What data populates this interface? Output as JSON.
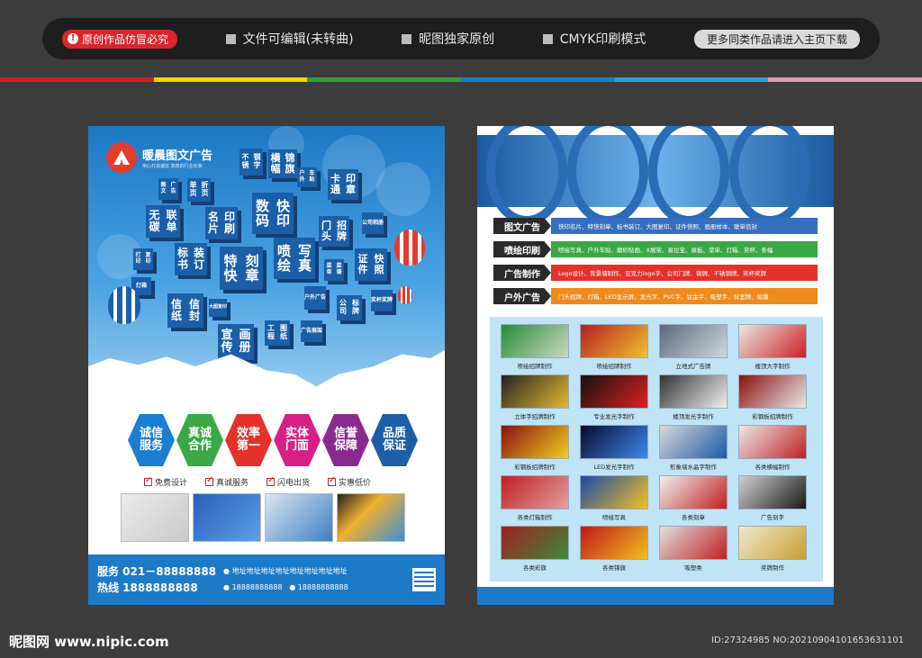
{
  "top_banner": {
    "badge": "原创作品仿冒必究",
    "item1": "文件可编辑(未转曲)",
    "item2": "昵图独家原创",
    "item3": "CMYK印刷模式",
    "more": "更多同类作品请进入主页下载"
  },
  "colors": {
    "bar": [
      "#d21f26",
      "#f5d800",
      "#2ca33a",
      "#1b7fc7",
      "#2ca0d8",
      "#e49aa9"
    ]
  },
  "left_flyer": {
    "brand": "暖晨图文广告",
    "brand_sub": "用心打造诚信   高效的行业标准",
    "cubes": [
      {
        "t": "不锈钢字"
      },
      {
        "t": "横幅锦旗"
      },
      {
        "t": "图文广告"
      },
      {
        "t": "单页折页"
      },
      {
        "t": "户外车贴"
      },
      {
        "t": "卡通印章"
      },
      {
        "t": "无碳联单"
      },
      {
        "t": "名片印刷"
      },
      {
        "t": "数码快印"
      },
      {
        "t": "门头招牌"
      },
      {
        "t": "公司相册"
      },
      {
        "t": "打印复印"
      },
      {
        "t": "标书装订"
      },
      {
        "t": "特快刻章"
      },
      {
        "t": "喷绘写真"
      },
      {
        "t": "证件快照"
      },
      {
        "t": "灯箱"
      },
      {
        "t": "菜单菜谱"
      },
      {
        "t": "信纸信封"
      },
      {
        "t": "大图复印"
      },
      {
        "t": "户外广告"
      },
      {
        "t": "公司标牌"
      },
      {
        "t": "奖杯奖牌"
      },
      {
        "t": "宣传画册"
      },
      {
        "t": "工程图纸"
      },
      {
        "t": "广告展架"
      }
    ],
    "hexes": [
      {
        "t": "诚信服务",
        "c": "#1a7fd0"
      },
      {
        "t": "真诚合作",
        "c": "#3aa845"
      },
      {
        "t": "效率第一",
        "c": "#e4322b"
      },
      {
        "t": "实体门面",
        "c": "#d81f83"
      },
      {
        "t": "信誉保障",
        "c": "#8a2a8f"
      },
      {
        "t": "品质保证",
        "c": "#1c5ea8"
      }
    ],
    "checks": [
      "免费设计",
      "真诚服务",
      "闪电出货",
      "实惠低价"
    ],
    "service_line": "服务 021－88888888",
    "hotline": "热线 1888888888",
    "address": "地址地址地址地址地址地址地址地址",
    "phone1": "18888888888",
    "phone2": "18888888888"
  },
  "right_flyer": {
    "services": [
      {
        "label": "图文广告",
        "text": "快印名片、特快刻章、标书装订、大图复印、证件快照、画册样本、联单信封",
        "c": "#3570c0"
      },
      {
        "label": "喷绘印刷",
        "text": "喷绘写真、户外车贴、磨砂贴画、X展架、易拉宝、展板、菜单、灯箱、奖杯、条幅",
        "c": "#3aa845"
      },
      {
        "label": "广告制作",
        "text": "Logo设计、背景墙制作、亚克力logo字、公司门牌、铜牌、不锈钢牌、奖杯奖牌",
        "c": "#e4322b"
      },
      {
        "label": "户外广告",
        "text": "门头招牌、灯箱、LED显示屏、发光字、PVC字、钛金字、吸塑字、科室牌、贴膜",
        "c": "#ef8a1c"
      }
    ],
    "cells": [
      {
        "cap": "喷绘招牌制作"
      },
      {
        "cap": "喷绘招牌制作"
      },
      {
        "cap": "立地式广告牌"
      },
      {
        "cap": "楼顶大字制作"
      },
      {
        "cap": "立体字招牌制作"
      },
      {
        "cap": "专业发光字制作"
      },
      {
        "cap": "楼顶发光字制作"
      },
      {
        "cap": "彩钢板招牌制作"
      },
      {
        "cap": "彩钢板招牌制作"
      },
      {
        "cap": "LED发光字制作"
      },
      {
        "cap": "形象墙水晶字制作"
      },
      {
        "cap": "各类横幅制作"
      },
      {
        "cap": "各类灯箱制作"
      },
      {
        "cap": "喷绘写真"
      },
      {
        "cap": "各类刻章"
      },
      {
        "cap": "广告刻字"
      },
      {
        "cap": "各类彩旗"
      },
      {
        "cap": "各类锦旗"
      },
      {
        "cap": "吸塑类"
      },
      {
        "cap": "奖牌制作"
      }
    ]
  },
  "watermark": {
    "left": "昵图网 www.nipic.com",
    "right": "ID:27324985 NO:20210904101653631101"
  }
}
